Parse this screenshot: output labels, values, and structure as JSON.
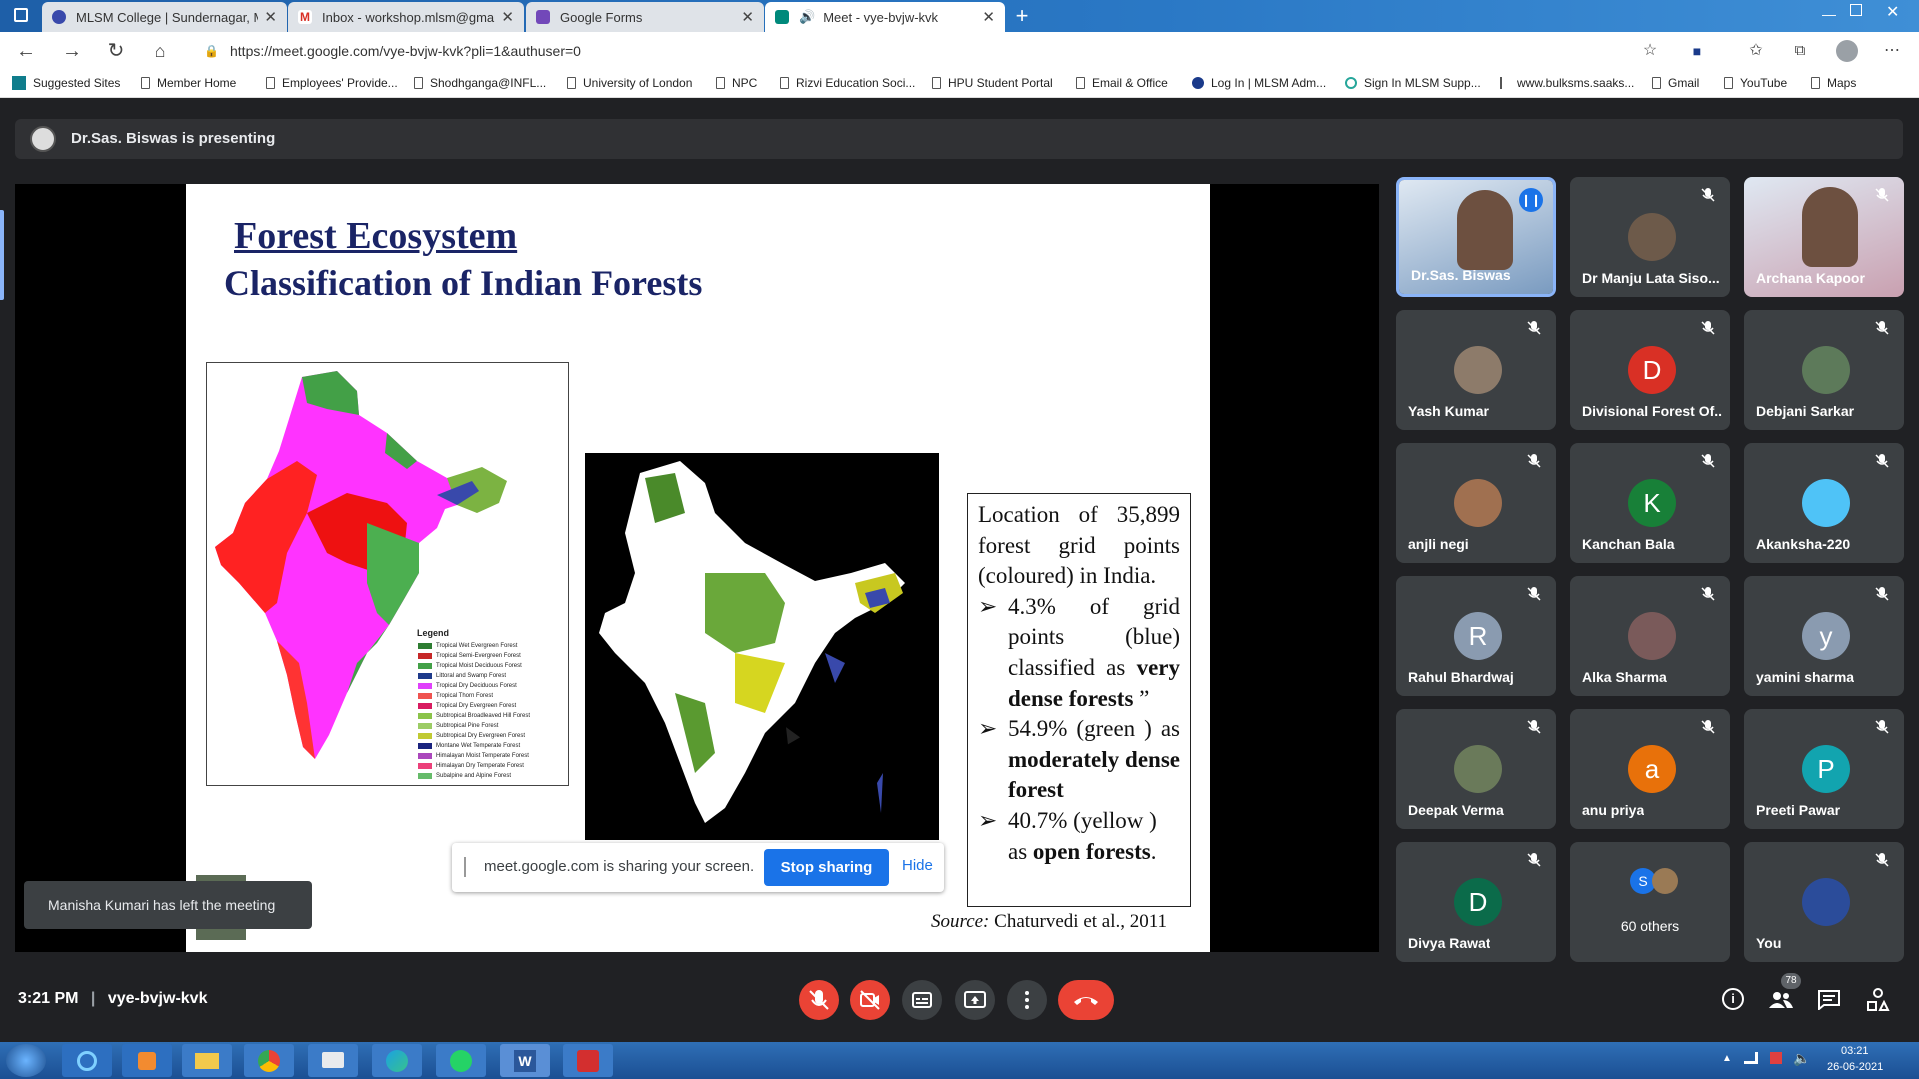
{
  "browser": {
    "tabs": [
      {
        "title": "MLSM College | Sundernagar, M",
        "icon": "college-favicon"
      },
      {
        "title": "Inbox - workshop.mlsm@gmail.c",
        "icon": "gmail-favicon"
      },
      {
        "title": "Google Forms",
        "icon": "forms-favicon"
      },
      {
        "title": "Meet - vye-bvjw-kvk",
        "icon": "meet-favicon"
      }
    ],
    "url": "https://meet.google.com/vye-bvjw-kvk?pli=1&authuser=0",
    "bookmarks": [
      "Suggested Sites",
      "Member Home",
      "Employees' Provide...",
      "Shodhganga@INFL...",
      "University of London",
      "NPC",
      "Rizvi Education Soci...",
      "HPU Student Portal",
      "Email & Office",
      "Log In | MLSM Adm...",
      "Sign In MLSM Supp...",
      "www.bulksms.saaks...",
      "Gmail",
      "YouTube",
      "Maps"
    ]
  },
  "meet": {
    "presenting_text": "Dr.Sas. Biswas is presenting",
    "slide": {
      "title": "Forest Ecosystem",
      "subtitle": "Classification of Indian Forests",
      "legend_title": "Legend",
      "legend_items": [
        {
          "label": "Tropical Wet Evergreen Forest",
          "color": "#2e7d32"
        },
        {
          "label": "Tropical Semi-Evergreen Forest",
          "color": "#c62828"
        },
        {
          "label": "Tropical Moist Deciduous Forest",
          "color": "#43a047"
        },
        {
          "label": "Littoral and Swamp Forest",
          "color": "#1e3a8a"
        },
        {
          "label": "Tropical Dry Deciduous Forest",
          "color": "#e040fb"
        },
        {
          "label": "Tropical Thorn Forest",
          "color": "#ef5350"
        },
        {
          "label": "Tropical Dry Evergreen Forest",
          "color": "#d81b60"
        },
        {
          "label": "Subtropical Broadleaved Hill Forest",
          "color": "#8bc34a"
        },
        {
          "label": "Subtropical Pine Forest",
          "color": "#9ccc65"
        },
        {
          "label": "Subtropical Dry Evergreen Forest",
          "color": "#c0ca33"
        },
        {
          "label": "Montane Wet Temperate Forest",
          "color": "#1a237e"
        },
        {
          "label": "Himalayan Moist Temperate Forest",
          "color": "#ab47bc"
        },
        {
          "label": "Himalayan Dry Temperate Forest",
          "color": "#ec407a"
        },
        {
          "label": "Subalpine and Alpine Forest",
          "color": "#66bb6a"
        }
      ],
      "text_lines": {
        "intro": "Location of 35,899 forest grid points (coloured) in India.",
        "b1a": "4.3% of grid points (blue) classified as",
        "b1b": "very dense forests",
        "b1c": " ”",
        "b2a": "54.9% (green ) as",
        "b2b": "moderately dense forest",
        "b3a": "40.7% (yellow ) as",
        "b3b": "open forests",
        "b3c": "."
      },
      "source_label": "Source:",
      "source_text": " Chaturvedi et al., 2011"
    },
    "share_bar": {
      "text": "meet.google.com is sharing your screen.",
      "stop": "Stop sharing",
      "hide": "Hide"
    },
    "toast": "Manisha Kumari has left the meeting",
    "participants": [
      {
        "name": "Dr.Sas. Biswas",
        "initial": "",
        "color": "#7a9bc0",
        "speaking": true
      },
      {
        "name": "Dr Manju Lata Siso...",
        "initial": "",
        "color": "#6d5a4a",
        "muted": true
      },
      {
        "name": "Archana Kapoor",
        "initial": "",
        "color": "#c9a0b0",
        "muted": true
      },
      {
        "name": "Yash Kumar",
        "initial": "",
        "color": "#8d7b6a",
        "muted": true
      },
      {
        "name": "Divisional Forest Of...",
        "initial": "D",
        "color": "#d93025",
        "muted": true
      },
      {
        "name": "Debjani Sarkar",
        "initial": "",
        "color": "#5d7a5a",
        "muted": true
      },
      {
        "name": "anjli negi",
        "initial": "",
        "color": "#a07050",
        "muted": true
      },
      {
        "name": "Kanchan Bala",
        "initial": "K",
        "color": "#188038",
        "muted": true
      },
      {
        "name": "Akanksha-220",
        "initial": "",
        "color": "#4fc3f7",
        "muted": true
      },
      {
        "name": "Rahul Bhardwaj",
        "initial": "R",
        "color": "#8a9bb0",
        "muted": true
      },
      {
        "name": "Alka Sharma",
        "initial": "",
        "color": "#7a5a5a",
        "muted": true
      },
      {
        "name": "yamini sharma",
        "initial": "y",
        "color": "#8a9bb0",
        "muted": true
      },
      {
        "name": "Deepak Verma",
        "initial": "",
        "color": "#6a7a5a",
        "muted": true
      },
      {
        "name": "anu priya",
        "initial": "a",
        "color": "#e8710a",
        "muted": true
      },
      {
        "name": "Preeti Pawar",
        "initial": "P",
        "color": "#12a4af",
        "muted": true
      },
      {
        "name": "Divya Rawat",
        "initial": "D",
        "color": "#0b6b4a",
        "muted": true
      },
      {
        "name": "60 others",
        "initial": "S",
        "color": "#1a73e8",
        "muted": false
      },
      {
        "name": "You",
        "initial": "",
        "color": "#2b4c9a",
        "muted": true
      }
    ],
    "clock": "3:21 PM",
    "meeting_code": "vye-bvjw-kvk",
    "people_count": "78"
  },
  "taskbar": {
    "time": "03:21",
    "date": "26-06-2021",
    "apps": [
      "start",
      "ie",
      "media-player",
      "file-explorer",
      "chrome",
      "feedback",
      "edge",
      "whatsapp",
      "word",
      "acrobat"
    ]
  }
}
